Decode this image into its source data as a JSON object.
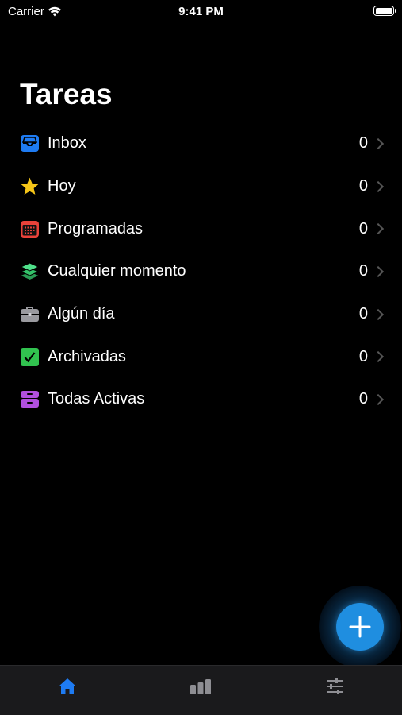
{
  "status_bar": {
    "carrier": "Carrier",
    "time": "9:41 PM"
  },
  "page": {
    "title": "Tareas"
  },
  "lists": [
    {
      "label": "Inbox",
      "count": "0",
      "icon": "inbox-icon",
      "color": "#1e7bf2"
    },
    {
      "label": "Hoy",
      "count": "0",
      "icon": "star-icon",
      "color": "#f5c518"
    },
    {
      "label": "Programadas",
      "count": "0",
      "icon": "calendar-icon",
      "color": "#e9423a"
    },
    {
      "label": "Cualquier momento",
      "count": "0",
      "icon": "layers-icon",
      "color": "#34c46a"
    },
    {
      "label": "Algún día",
      "count": "0",
      "icon": "briefcase-icon",
      "color": "#9a9a9f"
    },
    {
      "label": "Archivadas",
      "count": "0",
      "icon": "checkbox-icon",
      "color": "#31c24f"
    },
    {
      "label": "Todas Activas",
      "count": "0",
      "icon": "tray-icon",
      "color": "#b14fdf"
    }
  ],
  "tabbar": [
    {
      "icon": "home-icon",
      "active": true,
      "color": "#1e7bf2"
    },
    {
      "icon": "stats-icon",
      "active": false,
      "color": "#8e8e93"
    },
    {
      "icon": "sliders-icon",
      "active": false,
      "color": "#8e8e93"
    }
  ],
  "fab": {
    "icon": "plus-icon",
    "color": "#1f8ee0"
  }
}
